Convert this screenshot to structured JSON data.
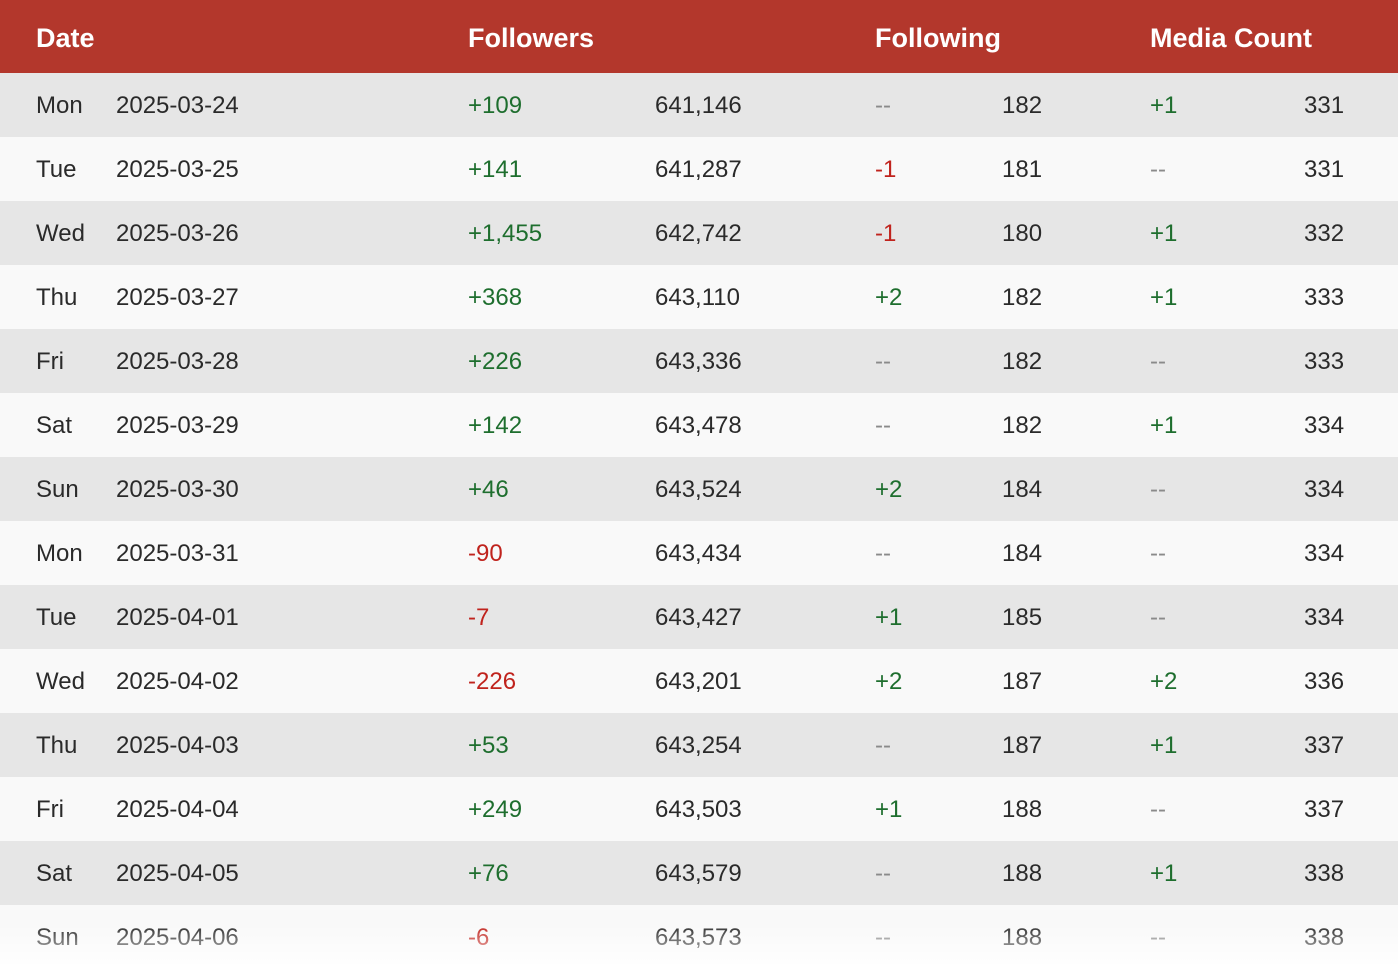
{
  "table": {
    "headers": {
      "date": "Date",
      "followers": "Followers",
      "following": "Following",
      "media_count": "Media Count"
    },
    "rows": [
      {
        "day": "Mon",
        "date": "2025-03-24",
        "followers_change": "+109",
        "followers": "641,146",
        "following_change": "--",
        "following": "182",
        "media_change": "+1",
        "media": "331"
      },
      {
        "day": "Tue",
        "date": "2025-03-25",
        "followers_change": "+141",
        "followers": "641,287",
        "following_change": "-1",
        "following": "181",
        "media_change": "--",
        "media": "331"
      },
      {
        "day": "Wed",
        "date": "2025-03-26",
        "followers_change": "+1,455",
        "followers": "642,742",
        "following_change": "-1",
        "following": "180",
        "media_change": "+1",
        "media": "332"
      },
      {
        "day": "Thu",
        "date": "2025-03-27",
        "followers_change": "+368",
        "followers": "643,110",
        "following_change": "+2",
        "following": "182",
        "media_change": "+1",
        "media": "333"
      },
      {
        "day": "Fri",
        "date": "2025-03-28",
        "followers_change": "+226",
        "followers": "643,336",
        "following_change": "--",
        "following": "182",
        "media_change": "--",
        "media": "333"
      },
      {
        "day": "Sat",
        "date": "2025-03-29",
        "followers_change": "+142",
        "followers": "643,478",
        "following_change": "--",
        "following": "182",
        "media_change": "+1",
        "media": "334"
      },
      {
        "day": "Sun",
        "date": "2025-03-30",
        "followers_change": "+46",
        "followers": "643,524",
        "following_change": "+2",
        "following": "184",
        "media_change": "--",
        "media": "334"
      },
      {
        "day": "Mon",
        "date": "2025-03-31",
        "followers_change": "-90",
        "followers": "643,434",
        "following_change": "--",
        "following": "184",
        "media_change": "--",
        "media": "334"
      },
      {
        "day": "Tue",
        "date": "2025-04-01",
        "followers_change": "-7",
        "followers": "643,427",
        "following_change": "+1",
        "following": "185",
        "media_change": "--",
        "media": "334"
      },
      {
        "day": "Wed",
        "date": "2025-04-02",
        "followers_change": "-226",
        "followers": "643,201",
        "following_change": "+2",
        "following": "187",
        "media_change": "+2",
        "media": "336"
      },
      {
        "day": "Thu",
        "date": "2025-04-03",
        "followers_change": "+53",
        "followers": "643,254",
        "following_change": "--",
        "following": "187",
        "media_change": "+1",
        "media": "337"
      },
      {
        "day": "Fri",
        "date": "2025-04-04",
        "followers_change": "+249",
        "followers": "643,503",
        "following_change": "+1",
        "following": "188",
        "media_change": "--",
        "media": "337"
      },
      {
        "day": "Sat",
        "date": "2025-04-05",
        "followers_change": "+76",
        "followers": "643,579",
        "following_change": "--",
        "following": "188",
        "media_change": "+1",
        "media": "338"
      },
      {
        "day": "Sun",
        "date": "2025-04-06",
        "followers_change": "-6",
        "followers": "643,573",
        "following_change": "--",
        "following": "188",
        "media_change": "--",
        "media": "338"
      }
    ]
  },
  "colors": {
    "header_bg": "#b3372c",
    "header_text": "#ffffff",
    "row_odd": "#e6e6e6",
    "row_even": "#f9f9f9",
    "positive": "#1e6e2e",
    "negative": "#c0231d",
    "no_change": "#8a8a8a",
    "text": "#2a2a2a"
  }
}
